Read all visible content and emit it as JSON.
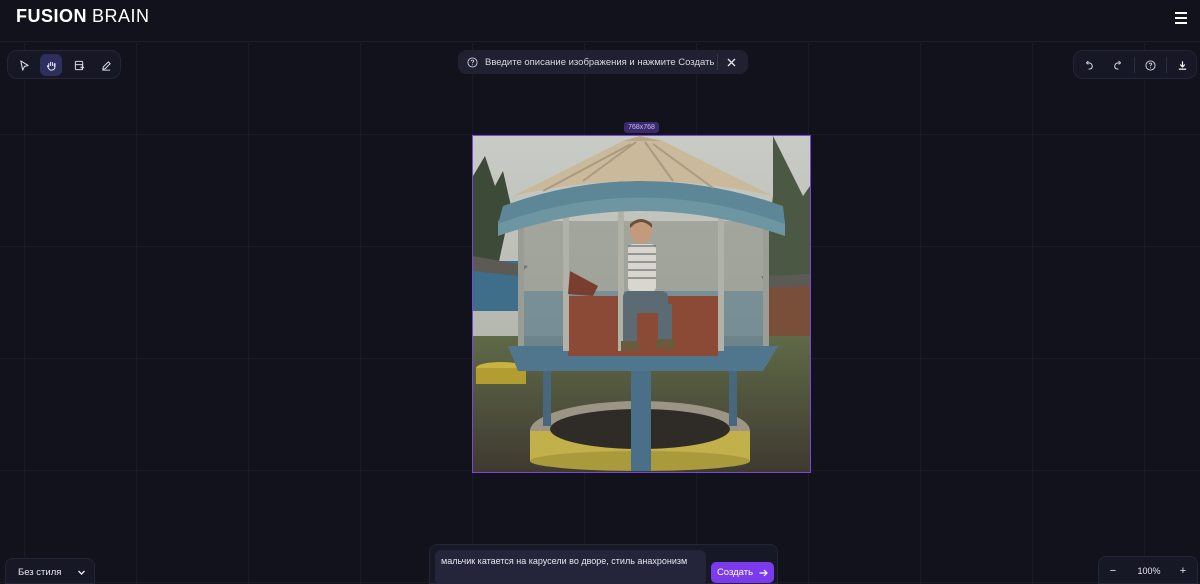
{
  "app": {
    "logo_primary": "FUSION",
    "logo_secondary": "BRAIN",
    "menu_icon": "hamburger-menu-icon"
  },
  "left_toolbar": {
    "tools": [
      {
        "name": "select",
        "icon": "cursor-icon",
        "active": false
      },
      {
        "name": "hand",
        "icon": "hand-icon",
        "active": true
      },
      {
        "name": "frame",
        "icon": "image-frame-icon",
        "active": false
      },
      {
        "name": "eraser",
        "icon": "pencil-icon",
        "active": false
      }
    ]
  },
  "notice": {
    "text": "Введите описание изображения и нажмите Создать",
    "icon": "help-circle-icon"
  },
  "right_toolbar": {
    "tools": [
      {
        "name": "undo",
        "icon": "undo-icon"
      },
      {
        "name": "redo",
        "icon": "redo-icon"
      },
      {
        "name": "help",
        "icon": "help-circle-icon"
      },
      {
        "name": "download",
        "icon": "download-icon"
      }
    ]
  },
  "canvas": {
    "size_label": "768x768",
    "accent_color": "#7b46e0"
  },
  "style_select": {
    "value": "Без стиля"
  },
  "prompt": {
    "value": "мальчик катается на карусели во дворе, стиль анахронизм",
    "button_label": "Создать"
  },
  "zoom": {
    "value": "100%",
    "minus_label": "−",
    "plus_label": "+"
  },
  "colors": {
    "background": "#11121c",
    "panel": "#171826",
    "accent": "#7c3aed"
  }
}
